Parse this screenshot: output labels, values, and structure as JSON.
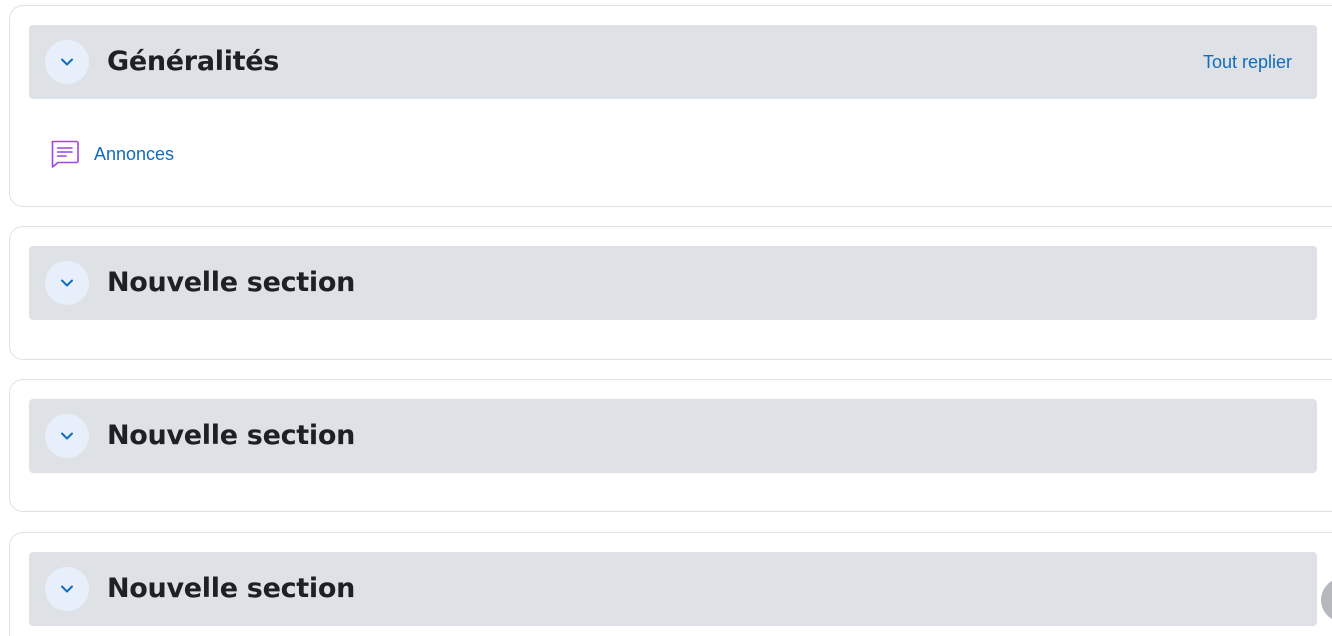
{
  "sections": [
    {
      "title": "Généralités",
      "collapse_all_label": "Tout replier",
      "activities": [
        {
          "name": "Annonces",
          "icon": "forum-icon"
        }
      ]
    },
    {
      "title": "Nouvelle section"
    },
    {
      "title": "Nouvelle section"
    },
    {
      "title": "Nouvelle section"
    }
  ],
  "colors": {
    "header_bg": "#dee2e6",
    "toggle_bg": "#e7f0fa",
    "link": "#0f6cbf",
    "title": "#1d2125",
    "forum_icon": "#a144e0"
  }
}
